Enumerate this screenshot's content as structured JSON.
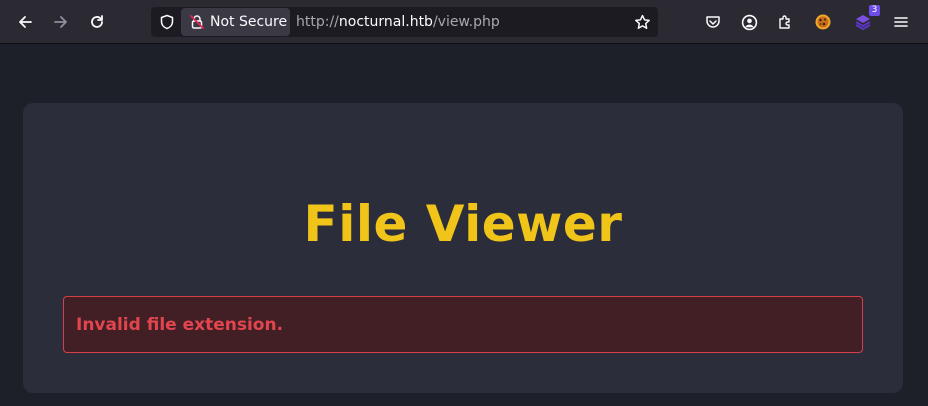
{
  "browser": {
    "identity_label": "Not Secure",
    "url_prefix": "http://",
    "url_host": "nocturnal.htb",
    "url_path": "/view.php",
    "extension_badge_count": "3",
    "icons": [
      "back-icon",
      "forward-icon",
      "reload-icon",
      "shield-icon",
      "lock-warning-icon",
      "star-icon",
      "pocket-icon",
      "account-icon",
      "extensions-icon",
      "cookie-extension-icon",
      "layers-extension-icon",
      "menu-icon"
    ]
  },
  "page": {
    "title": "File Viewer",
    "error_message": "Invalid file extension."
  },
  "colors": {
    "title": "#f0c419",
    "error_text": "#e2454e",
    "error_border": "#d3404a",
    "error_bg": "#411f25",
    "card_bg": "#2b2e3a",
    "page_bg": "#1d2029"
  }
}
